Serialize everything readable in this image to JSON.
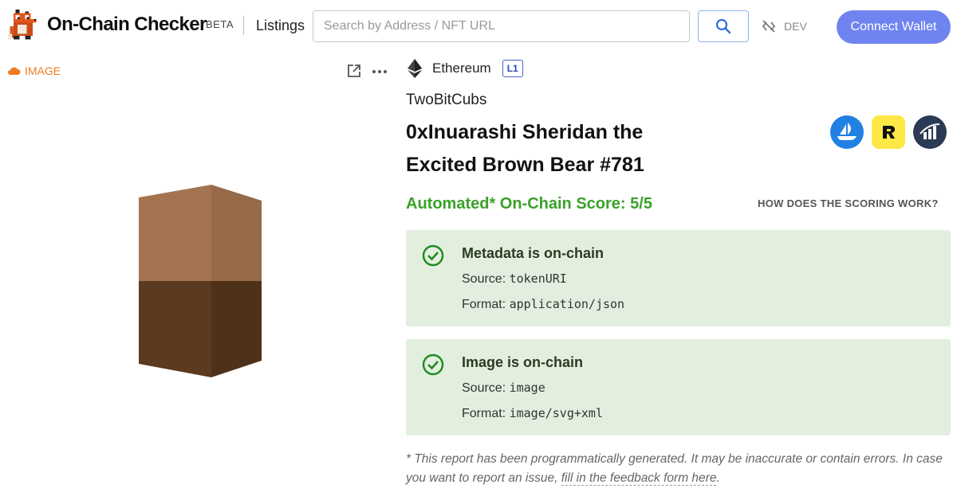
{
  "header": {
    "brand": "On-Chain Checker",
    "beta": "BETA",
    "listings": "Listings",
    "search_placeholder": "Search by Address / NFT URL",
    "dev": "DEV",
    "connect": "Connect Wallet"
  },
  "image_panel": {
    "tag": "IMAGE"
  },
  "nft": {
    "chain": "Ethereum",
    "layer": "L1",
    "collection": "TwoBitCubs",
    "title": "0xInuarashi Sheridan the Excited Brown Bear #781",
    "score": "Automated* On-Chain Score: 5/5",
    "how": "HOW DOES THE SCORING WORK?",
    "marketplaces": [
      "opensea",
      "rarible",
      "looksrare"
    ]
  },
  "checks": [
    {
      "title": "Metadata is on-chain",
      "source_label": "Source:",
      "source": "tokenURI",
      "format_label": "Format:",
      "format": "application/json"
    },
    {
      "title": "Image is on-chain",
      "source_label": "Source:",
      "source": "image",
      "format_label": "Format:",
      "format": "image/svg+xml"
    }
  ],
  "disclaimer": {
    "text": "* This report has been programmatically generated. It may be inaccurate or contain errors. In case you want to report an issue,",
    "link": "fill in the feedback form here",
    "end": "."
  },
  "colors": {
    "accent": "#6f84f0",
    "score": "#3aa128",
    "card_bg": "#e2efdf",
    "image_tag": "#f07c22",
    "cube_top_left": "#a47450",
    "cube_top_right": "#976a48",
    "cube_bottom_left": "#5b3a1f",
    "cube_bottom_right": "#4f3119"
  }
}
